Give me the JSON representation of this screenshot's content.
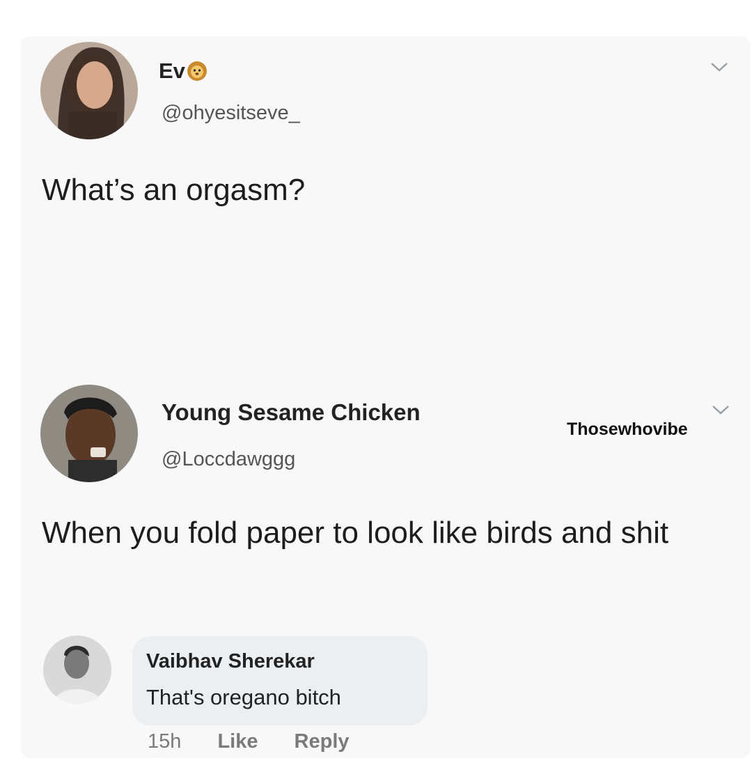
{
  "tweet1": {
    "display_name": "Ev",
    "emoji_icon": "lion-face-icon",
    "handle": "@ohyesitseve_",
    "text": "What’s an orgasm?"
  },
  "tweet2": {
    "display_name": "Young Sesame Chicken",
    "handle": "@Loccdawggg",
    "text": "When you fold paper to look like birds and shit"
  },
  "watermark": "Thosewhovibe",
  "comment": {
    "name": "Vaibhav Sherekar",
    "text": "That's oregano bitch",
    "time": "15h",
    "like_label": "Like",
    "reply_label": "Reply"
  },
  "colors": {
    "card_background": "#f7f8f7",
    "comment_bubble": "#eceff2",
    "meta_gray": "#7a7a7a"
  }
}
